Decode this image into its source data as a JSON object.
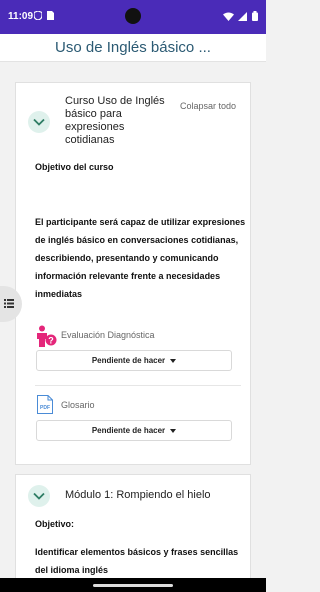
{
  "status_bar": {
    "time": "11:09",
    "left_icons": [
      "shield-icon",
      "sim-card-icon"
    ],
    "right_icons": [
      "wifi-icon",
      "signal-icon",
      "battery-icon"
    ],
    "color": "#4a2bb8"
  },
  "header": {
    "title": "Uso de Inglés básico ..."
  },
  "course_section": {
    "title": "Curso Uso de Inglés básico para expresiones cotidianas",
    "collapse_all_label": "Colapsar todo",
    "objective_heading": "Objetivo del curso",
    "objective_text": "El participante será capaz de utilizar expresiones de inglés básico en conversaciones cotidianas, describiendo, presentando y comunicando información relevante frente a necesidades inmediatas",
    "activities": [
      {
        "label": "Evaluación Diagnóstica",
        "icon": "person-question-icon",
        "status": "Pendiente de hacer"
      },
      {
        "label": "Glosario",
        "icon": "pdf-icon",
        "status": "Pendiente de hacer"
      }
    ]
  },
  "module_section": {
    "title": "Módulo 1: Rompiendo el hielo",
    "objective_heading": "Objetivo:",
    "objective_text": "Identificar elementos básicos y frases sencillas del idioma inglés"
  },
  "colors": {
    "accent": "#2b5a73",
    "chevron_bg": "#dff1ec",
    "chevron": "#2e7d64",
    "activity_icon": "#e4267a"
  }
}
